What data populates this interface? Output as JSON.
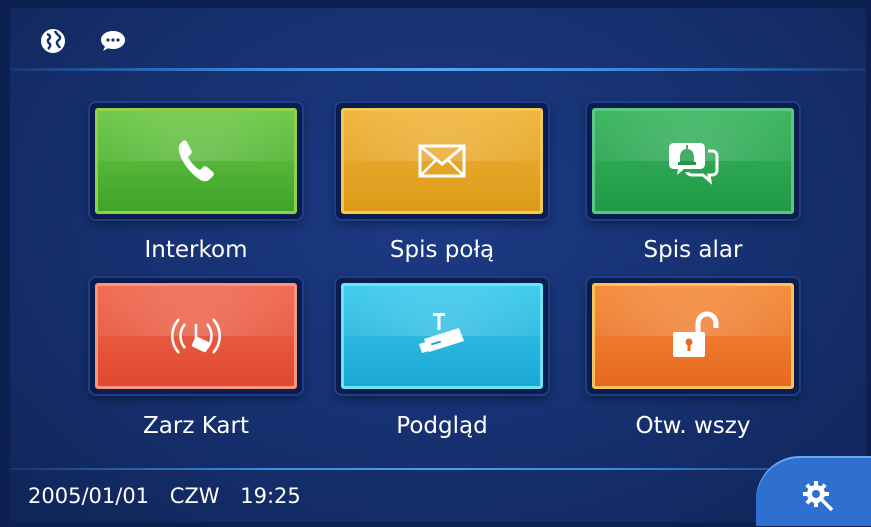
{
  "header": {
    "globe_icon": "globe-icon",
    "chat_icon": "chat-bubble-icon"
  },
  "menu": {
    "tiles": [
      {
        "label": "Interkom",
        "icon": "phone-icon",
        "border": "#8fd24a",
        "fill": "#4eb233"
      },
      {
        "label": "Spis połą",
        "icon": "envelope-icon",
        "border": "#f3c84e",
        "fill": "#e3a420"
      },
      {
        "label": "Spis alar",
        "icon": "alarm-chat-icon",
        "border": "#5cc783",
        "fill": "#29a852"
      },
      {
        "label": "Zarz Kart",
        "icon": "rfid-card-icon",
        "border": "#f59680",
        "fill": "#e8543c"
      },
      {
        "label": "Podgląd",
        "icon": "camera-icon",
        "border": "#6fe3f6",
        "fill": "#27b8e0"
      },
      {
        "label": "Otw. wszy",
        "icon": "unlock-icon",
        "border": "#f8c35a",
        "fill": "#ee7c2a"
      }
    ]
  },
  "status": {
    "date": "2005/01/01",
    "weekday": "CZW",
    "time": "19:25"
  },
  "settings": {
    "icon": "gear-wrench-icon",
    "color": "#2f6fd0"
  }
}
